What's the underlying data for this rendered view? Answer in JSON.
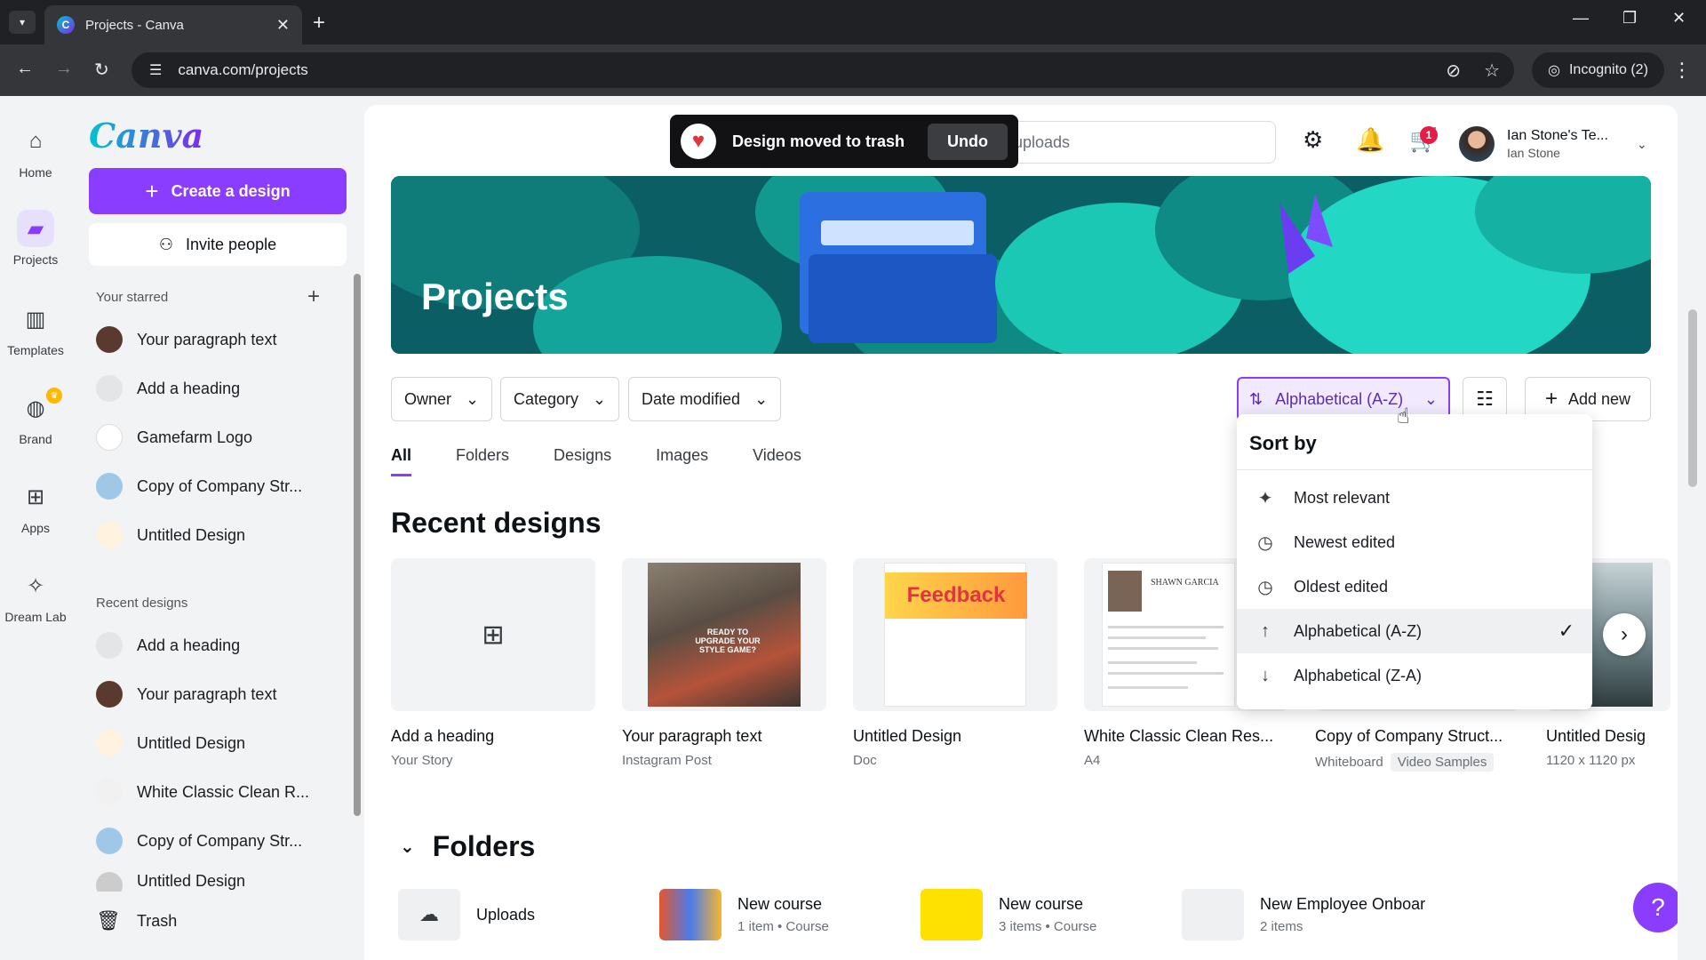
{
  "browser": {
    "tab_title": "Projects - Canva",
    "url": "canva.com/projects",
    "incognito_label": "Incognito (2)"
  },
  "rail": {
    "items": [
      {
        "label": "Home",
        "icon": "home-icon"
      },
      {
        "label": "Projects",
        "icon": "folder-icon",
        "active": true
      },
      {
        "label": "Templates",
        "icon": "templates-icon"
      },
      {
        "label": "Brand",
        "icon": "brand-icon"
      },
      {
        "label": "Apps",
        "icon": "apps-icon"
      },
      {
        "label": "Dream Lab",
        "icon": "dream-lab-icon"
      }
    ]
  },
  "sidebar": {
    "logo": "Canva",
    "create_label": "Create a design",
    "invite_label": "Invite people",
    "starred_label": "Your starred",
    "starred": [
      {
        "label": "Your paragraph text",
        "thumb": "#5a3a2f"
      },
      {
        "label": "Add a heading",
        "thumb": "#e4e5e7"
      },
      {
        "label": "Gamefarm Logo",
        "thumb": "#ffffff"
      },
      {
        "label": "Copy of Company Str...",
        "thumb": "#9ec7e8"
      },
      {
        "label": "Untitled Design",
        "thumb": "#fff3e0"
      }
    ],
    "recent_label": "Recent designs",
    "recent": [
      {
        "label": "Add a heading",
        "thumb": "#e4e5e7"
      },
      {
        "label": "Your paragraph text",
        "thumb": "#5a3a2f"
      },
      {
        "label": "Untitled Design",
        "thumb": "#fff3e0"
      },
      {
        "label": "White Classic Clean R...",
        "thumb": "#f1f1f1"
      },
      {
        "label": "Copy of Company Str...",
        "thumb": "#9ec7e8"
      },
      {
        "label": "Untitled Design",
        "thumb": "#cccccc"
      }
    ],
    "trash_label": "Trash"
  },
  "topbar": {
    "search_placeholder": "uploads",
    "cart_count": "1",
    "account_title": "Ian Stone's Te...",
    "account_sub": "Ian Stone"
  },
  "toast": {
    "message": "Design moved to trash",
    "undo_label": "Undo"
  },
  "banner": {
    "title": "Projects"
  },
  "filters": {
    "owner": "Owner",
    "category": "Category",
    "date_modified": "Date modified",
    "sort_label": "Alphabetical (A-Z)",
    "add_new": "Add new"
  },
  "tabs": [
    "All",
    "Folders",
    "Designs",
    "Images",
    "Videos"
  ],
  "recent": {
    "title": "Recent designs",
    "cards": [
      {
        "title": "Add a heading",
        "sub": "Your Story"
      },
      {
        "title": "Your paragraph text",
        "sub": "Instagram Post",
        "preview_text": "READY TO UPGRADE YOUR STYLE GAME?"
      },
      {
        "title": "Untitled Design",
        "sub": "Doc",
        "preview_text": "Feedback"
      },
      {
        "title": "White Classic Clean Res...",
        "sub": "A4",
        "preview_text": "SHAWN GARCIA"
      },
      {
        "title": "Copy of Company Struct...",
        "sub": "Whiteboard",
        "tag": "Video Samples"
      },
      {
        "title": "Untitled Desig",
        "sub": "1120 x 1120 px"
      }
    ]
  },
  "folders": {
    "title": "Folders",
    "items": [
      {
        "title": "Uploads",
        "sub": ""
      },
      {
        "title": "New course",
        "sub": "1 item • Course"
      },
      {
        "title": "New course",
        "sub": "3 items • Course"
      },
      {
        "title": "New Employee Onboar",
        "sub": "2 items"
      }
    ]
  },
  "sort_menu": {
    "title": "Sort by",
    "options": [
      {
        "label": "Most relevant",
        "icon": "sparkle-icon"
      },
      {
        "label": "Newest edited",
        "icon": "clock-icon"
      },
      {
        "label": "Oldest edited",
        "icon": "clock-icon"
      },
      {
        "label": "Alphabetical (A-Z)",
        "icon": "arrow-up-icon",
        "selected": true
      },
      {
        "label": "Alphabetical (Z-A)",
        "icon": "arrow-down-icon"
      }
    ]
  },
  "colors": {
    "accent": "#8b3dff",
    "toast_bg": "#121214"
  }
}
